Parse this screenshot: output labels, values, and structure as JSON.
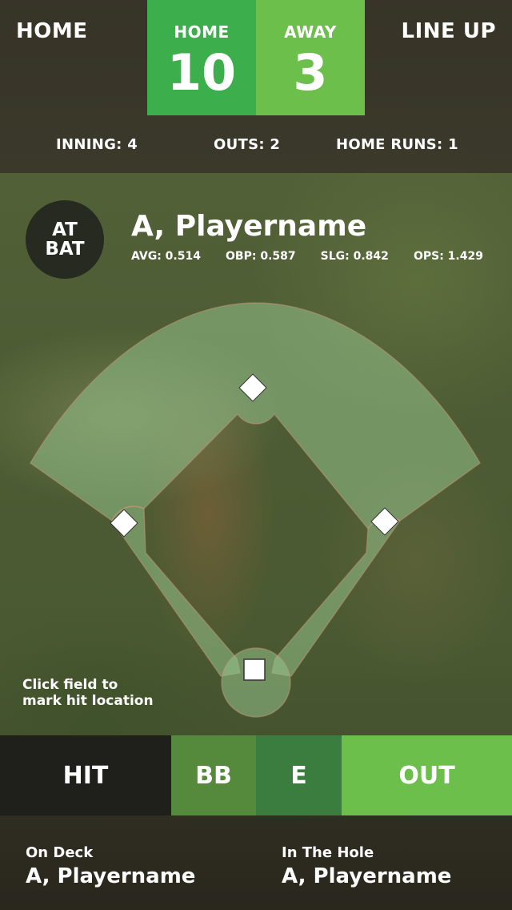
{
  "nav": {
    "home_label": "HOME",
    "lineup_label": "LINE UP"
  },
  "scoreboard": {
    "home": {
      "label": "HOME",
      "score": "10"
    },
    "away": {
      "label": "AWAY",
      "score": "3"
    }
  },
  "game_status": {
    "inning": "INNING:  4",
    "outs": "OUTS:  2",
    "home_runs": "HOME RUNS:  1"
  },
  "at_bat": {
    "badge_line1": "AT",
    "badge_line2": "BAT",
    "player_name": "A, Playername",
    "stats": {
      "avg": "AVG: 0.514",
      "obp": "OBP: 0.587",
      "slg": "SLG: 0.842",
      "ops": "OPS: 1.429"
    }
  },
  "field": {
    "hint_line1": "Click field to",
    "hint_line2": "mark hit location"
  },
  "actions": {
    "hit": "HIT",
    "bb": "BB",
    "e": "E",
    "out": "OUT"
  },
  "lineup": {
    "on_deck_label": "On Deck",
    "on_deck_name": "A, Playername",
    "in_hole_label": "In The Hole",
    "in_hole_name": "A, Playername"
  },
  "colors": {
    "home_score_bg": "#3cae4c",
    "away_score_bg": "#6cbf4a",
    "hit_bg": "#1f201c",
    "bb_bg": "#558a3c",
    "e_bg": "#3b7c3f",
    "out_bg": "#6cbf4a"
  }
}
